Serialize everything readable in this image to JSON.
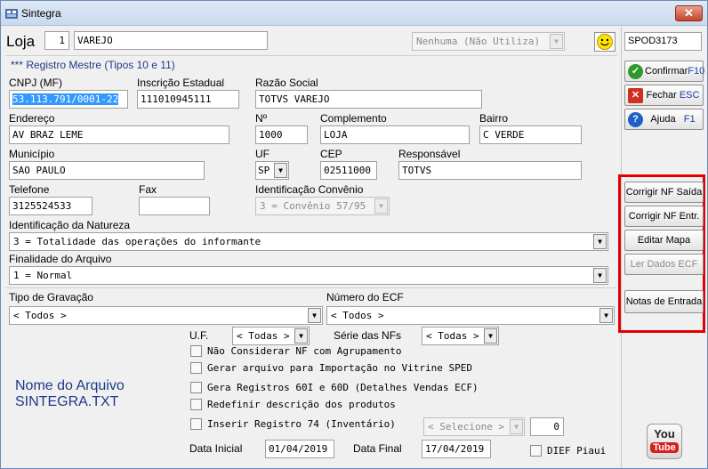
{
  "window": {
    "title": "Sintegra",
    "close_label": "✕"
  },
  "loja": {
    "label": "Loja",
    "code": "1",
    "name": "VAREJO"
  },
  "utiliza": {
    "value": "Nenhuma (Não Utiliza)"
  },
  "spod": {
    "value": "SPOD3173"
  },
  "section_title": "*** Registro Mestre (Tipos 10 e 11)",
  "labels": {
    "cnpj": "CNPJ (MF)",
    "ie": "Inscrição Estadual",
    "razao": "Razão Social",
    "endereco": "Endereço",
    "numero": "Nº",
    "complemento": "Complemento",
    "bairro": "Bairro",
    "municipio": "Município",
    "uf": "UF",
    "cep": "CEP",
    "responsavel": "Responsável",
    "telefone": "Telefone",
    "fax": "Fax",
    "convenio": "Identificação Convênio",
    "natureza": "Identificação da Natureza",
    "finalidade": "Finalidade do Arquivo",
    "tipo_gravacao": "Tipo de Gravação",
    "numero_ecf": "Número do ECF",
    "uf2": "U.F.",
    "serie": "Série das NFs",
    "data_inicial": "Data Inicial",
    "data_final": "Data Final"
  },
  "fields": {
    "cnpj": "53.113.791/0001-22",
    "ie": "111010945111",
    "razao": "TOTVS VAREJO",
    "endereco": "AV BRAZ LEME",
    "numero": "1000",
    "complemento": "LOJA",
    "bairro": "C VERDE",
    "municipio": "SAO PAULO",
    "uf": "SP",
    "cep": "02511000",
    "responsavel": "TOTVS",
    "telefone": "3125524533",
    "fax": "",
    "convenio": "3 = Convênio 57/95",
    "natureza": "3 = Totalidade das operações do informante",
    "finalidade": "1 = Normal",
    "tipo_gravacao": "< Todos >",
    "numero_ecf": "< Todos >",
    "uf2": "< Todas >",
    "serie": "< Todas >",
    "data_inicial": "01/04/2019",
    "data_final": "17/04/2019",
    "registro74_select": "< Selecione >",
    "registro74_count": "0"
  },
  "checkboxes": [
    "Não Considerar NF com Agrupamento",
    "Gerar arquivo para Importação no Vitrine SPED",
    "Gera Registros 60I e 60D (Detalhes Vendas ECF)",
    "Redefinir descrição dos produtos",
    "Inserir Registro 74 (Inventário)"
  ],
  "dief": "DIEF Piaui",
  "nome_arquivo": {
    "line1": "Nome do Arquivo",
    "line2": "SINTEGRA.TXT"
  },
  "side": {
    "confirmar": "Confirmar",
    "confirmar_key": "F10",
    "fechar": "Fechar",
    "fechar_key": "ESC",
    "ajuda": "Ajuda",
    "ajuda_key": "F1",
    "corrigir_saida": "Corrigir NF Saída",
    "corrigir_entrada": "Corrigir NF Entr.",
    "editar_mapa": "Editar Mapa",
    "ler_dados": "Ler Dados ECF",
    "notas_entrada": "Notas de Entrada",
    "youtube_top": "You",
    "youtube_bottom": "Tube"
  },
  "colors": {
    "accent": "#1e3a8a",
    "highlight": "#e00000",
    "selection": "#3399ff"
  }
}
